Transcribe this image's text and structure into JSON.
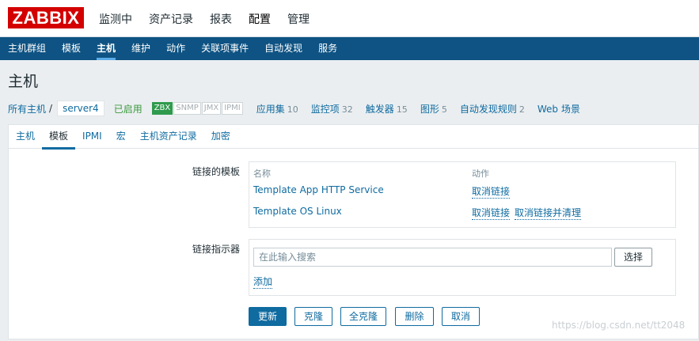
{
  "logo": "ZABBIX",
  "top_nav": [
    "监测中",
    "资产记录",
    "报表",
    "配置",
    "管理"
  ],
  "sub_nav": [
    "主机群组",
    "模板",
    "主机",
    "维护",
    "动作",
    "关联项事件",
    "自动发现",
    "服务"
  ],
  "page_title": "主机",
  "hostbar": {
    "all_hosts": "所有主机",
    "separator": "/",
    "host": "server4",
    "status": "已启用",
    "badges": [
      {
        "label": "ZBX",
        "active": true
      },
      {
        "label": "SNMP",
        "active": false
      },
      {
        "label": "JMX",
        "active": false
      },
      {
        "label": "IPMI",
        "active": false
      }
    ],
    "metrics": [
      {
        "label": "应用集",
        "count": "10"
      },
      {
        "label": "监控项",
        "count": "32"
      },
      {
        "label": "触发器",
        "count": "15"
      },
      {
        "label": "图形",
        "count": "5"
      },
      {
        "label": "自动发现规则",
        "count": "2"
      },
      {
        "label": "Web 场景",
        "count": ""
      }
    ]
  },
  "tabs": [
    "主机",
    "模板",
    "IPMI",
    "宏",
    "主机资产记录",
    "加密"
  ],
  "form": {
    "linked_templates_label": "链接的模板",
    "col_name": "名称",
    "col_action": "动作",
    "templates": [
      {
        "name": "Template App HTTP Service",
        "unlink": "取消链接",
        "unlink_clear": ""
      },
      {
        "name": "Template OS Linux",
        "unlink": "取消链接",
        "unlink_clear": "取消链接并清理"
      }
    ],
    "link_indicator_label": "链接指示器",
    "search_placeholder": "在此输入搜索",
    "select_button": "选择",
    "add_link": "添加"
  },
  "buttons": {
    "update": "更新",
    "clone": "克隆",
    "full_clone": "全克隆",
    "delete": "删除",
    "cancel": "取消"
  },
  "watermark": "https://blog.csdn.net/tt2048",
  "colors": {
    "brand_red": "#d40000",
    "nav_blue": "#0e5383",
    "link_blue": "#0f6ba0",
    "enabled_green": "#3a9a3e"
  }
}
